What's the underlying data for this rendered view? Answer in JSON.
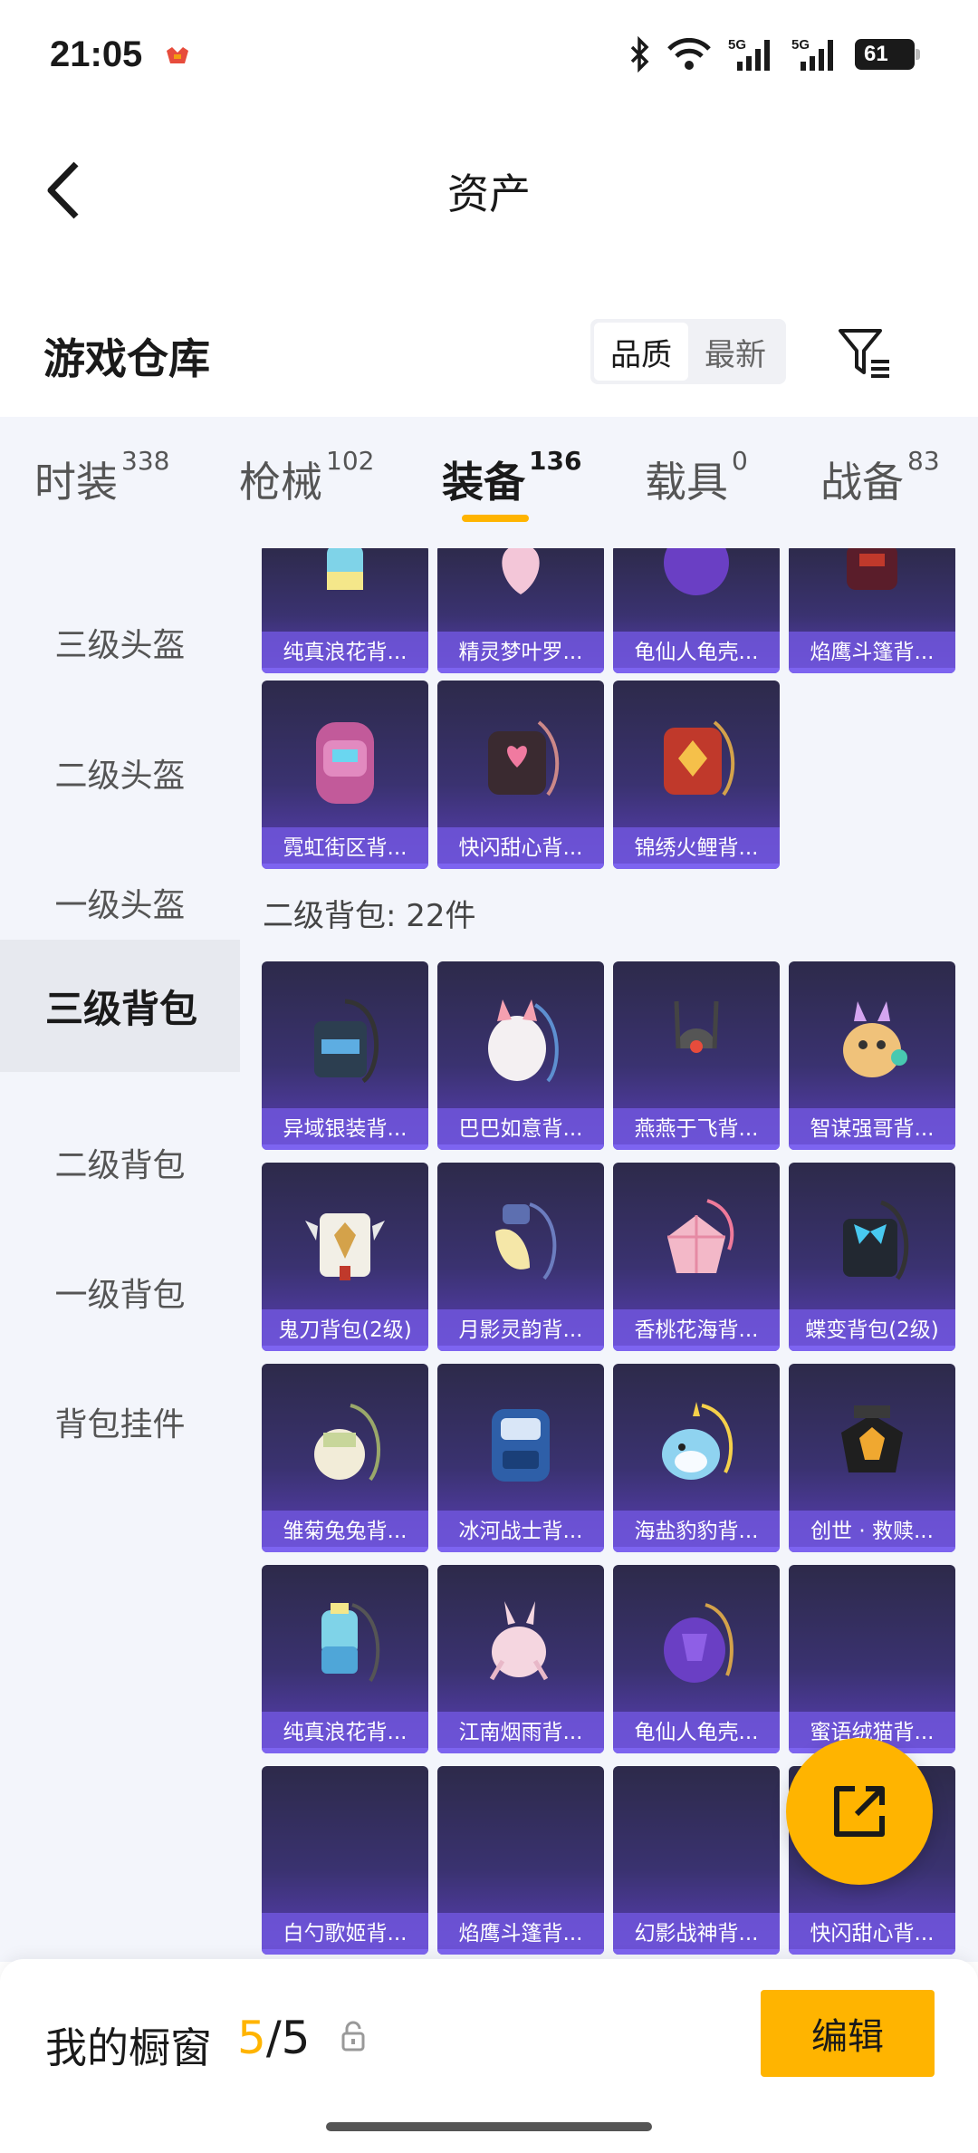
{
  "status": {
    "time": "21:05",
    "battery": "61"
  },
  "header": {
    "title": "资产"
  },
  "warehouse": {
    "title": "游戏仓库",
    "sort_quality": "品质",
    "sort_latest": "最新"
  },
  "tabs": [
    {
      "label": "时装",
      "count": "338"
    },
    {
      "label": "枪械",
      "count": "102"
    },
    {
      "label": "装备",
      "count": "136"
    },
    {
      "label": "载具",
      "count": "0"
    },
    {
      "label": "战备",
      "count": "83"
    }
  ],
  "sidebar": [
    "三级头盔",
    "二级头盔",
    "一级头盔",
    "三级背包",
    "二级背包",
    "一级背包",
    "背包挂件"
  ],
  "section_level3_items": [
    "纯真浪花背...",
    "精灵梦叶罗...",
    "龟仙人龟壳...",
    "焰鹰斗篷背...",
    "霓虹街区背...",
    "快闪甜心背...",
    "锦绣火鲤背..."
  ],
  "section_level2": {
    "title": "二级背包: 22件",
    "items": [
      "异域银装背...",
      "巴巴如意背...",
      "燕燕于飞背...",
      "智谋强哥背...",
      "鬼刀背包(2级)",
      "月影灵韵背...",
      "香桃花海背...",
      "蝶变背包(2级)",
      "雏菊兔兔背...",
      "冰河战士背...",
      "海盐豹豹背...",
      "创世 · 救赎...",
      "纯真浪花背...",
      "江南烟雨背...",
      "龟仙人龟壳...",
      "蜜语绒猫背...",
      "白勺歌姬背...",
      "焰鹰斗篷背...",
      "幻影战神背...",
      "快闪甜心背..."
    ]
  },
  "bottom": {
    "label": "我的橱窗",
    "count_current": "5",
    "count_sep": "/",
    "count_total": "5",
    "edit": "编辑"
  },
  "colors": {
    "accent": "#ffb400",
    "card_top": "#2d2a4a",
    "card_bottom": "#5a3fb8"
  }
}
